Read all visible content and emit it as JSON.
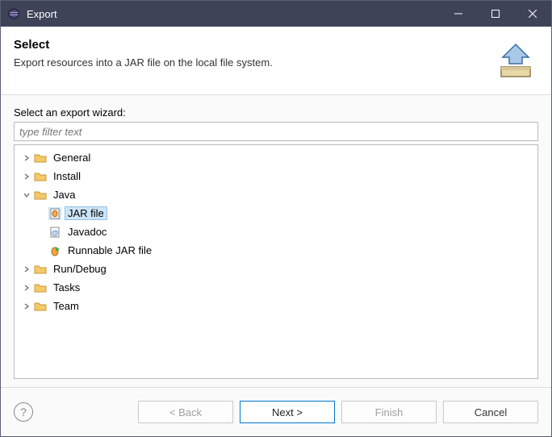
{
  "titlebar": {
    "title": "Export"
  },
  "header": {
    "title": "Select",
    "description": "Export resources into a JAR file on the local file system."
  },
  "content": {
    "label": "Select an export wizard:",
    "filter_placeholder": "type filter text"
  },
  "tree": {
    "general": {
      "label": "General"
    },
    "install": {
      "label": "Install"
    },
    "java": {
      "label": "Java",
      "jar": "JAR file",
      "javadoc": "Javadoc",
      "runnable": "Runnable JAR file"
    },
    "rundebug": {
      "label": "Run/Debug"
    },
    "tasks": {
      "label": "Tasks"
    },
    "team": {
      "label": "Team"
    }
  },
  "footer": {
    "back": "< Back",
    "next": "Next >",
    "finish": "Finish",
    "cancel": "Cancel"
  }
}
